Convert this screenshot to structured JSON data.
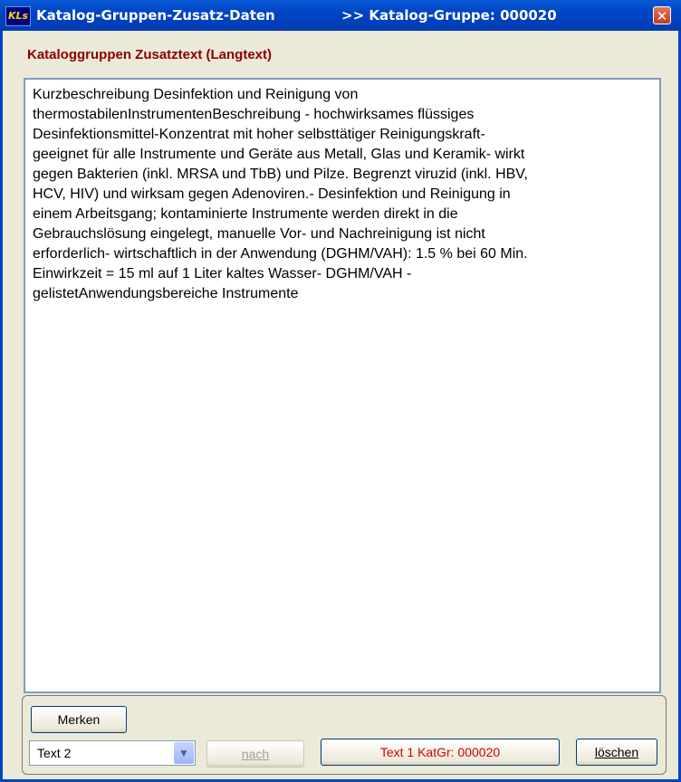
{
  "window": {
    "icon": "KLs",
    "title": "Katalog-Gruppen-Zusatz-Daten",
    "group_label": ">> Katalog-Gruppe: 000020",
    "close_glyph": "✕"
  },
  "section": {
    "label": "Kataloggruppen Zusatztext (Langtext)"
  },
  "editor": {
    "text": "Kurzbeschreibung Desinfektion und Reinigung von\nthermostabilenInstrumentenBeschreibung - hochwirksames flüssiges\nDesinfektionsmittel-Konzentrat mit hoher selbsttätiger Reinigungskraft-\ngeeignet für alle Instrumente und Geräte aus Metall, Glas und Keramik- wirkt\ngegen Bakterien (inkl. MRSA und TbB) und Pilze. Begrenzt viruzid (inkl. HBV,\nHCV, HIV) und wirksam gegen Adenoviren.- Desinfektion und Reinigung in\neinem Arbeitsgang; kontaminierte Instrumente werden direkt in die\nGebrauchslösung eingelegt, manuelle Vor- und Nachreinigung ist nicht\nerforderlich- wirtschaftlich in der Anwendung (DGHM/VAH): 1.5 % bei 60 Min.\nEinwirkzeit = 15 ml auf 1 Liter kaltes Wasser- DGHM/VAH -\ngelistetAnwendungsbereiche Instrumente"
  },
  "controls": {
    "merken_label": "Merken",
    "text_select_value": "Text 2",
    "nach_label": "nach",
    "text_button_label": "Text 1  KatGr: 000020",
    "loeschen_label": "löschen"
  },
  "colors": {
    "title_bar": "#0044c4",
    "section_label": "#8b0000",
    "text_button": "#d40000"
  },
  "icons": {
    "close": "close-icon",
    "dropdown": "chevron-down-icon"
  }
}
